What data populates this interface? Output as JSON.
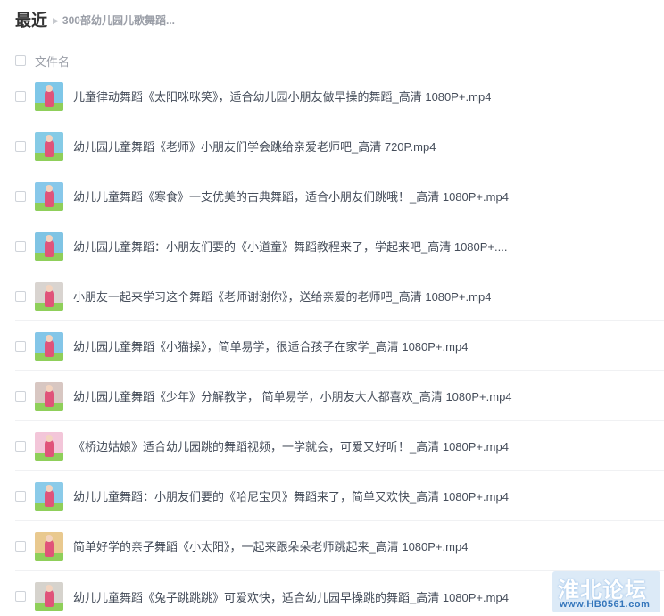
{
  "breadcrumb": {
    "root": "最近",
    "folder": "300部幼儿园儿歌舞蹈..."
  },
  "list_header": {
    "column_label": "文件名"
  },
  "files": [
    {
      "name": "儿童律动舞蹈《太阳咪咪笑》，适合幼儿园小朋友做早操的舞蹈_高清 1080P+.mp4",
      "thumb_color": "#7fc7e8"
    },
    {
      "name": "幼儿园儿童舞蹈《老师》小朋友们学会跳给亲爱老师吧_高清 720P.mp4",
      "thumb_color": "#86cbe6"
    },
    {
      "name": "幼儿儿童舞蹈《寒食》一支优美的古典舞蹈，适合小朋友们跳哦！_高清 1080P+.mp4",
      "thumb_color": "#88c8ea"
    },
    {
      "name": "幼儿园儿童舞蹈：小朋友们要的《小道童》舞蹈教程来了，学起来吧_高清 1080P+....",
      "thumb_color": "#80c4e4"
    },
    {
      "name": "小朋友一起来学习这个舞蹈《老师谢谢你》，送给亲爱的老师吧_高清 1080P+.mp4",
      "thumb_color": "#d9d4d0"
    },
    {
      "name": "幼儿园儿童舞蹈《小猫操》，简单易学，很适合孩子在家学_高清 1080P+.mp4",
      "thumb_color": "#84c6e8"
    },
    {
      "name": "幼儿园儿童舞蹈《少年》分解教学， 简单易学，小朋友大人都喜欢_高清 1080P+.mp4",
      "thumb_color": "#d8c7c2"
    },
    {
      "name": "《桥边姑娘》适合幼儿园跳的舞蹈视频，一学就会，可爱又好听！_高清 1080P+.mp4",
      "thumb_color": "#f3c6d9"
    },
    {
      "name": "幼儿儿童舞蹈：小朋友们要的《哈尼宝贝》舞蹈来了，简单又欢快_高清 1080P+.mp4",
      "thumb_color": "#8bcbe9"
    },
    {
      "name": "简单好学的亲子舞蹈《小太阳》，一起来跟朵朵老师跳起来_高清 1080P+.mp4",
      "thumb_color": "#e9c98f"
    },
    {
      "name": "幼儿儿童舞蹈《兔子跳跳跳》可爱欢快，适合幼儿园早操跳的舞蹈_高清 1080P+.mp4",
      "thumb_color": "#d6d3cd"
    }
  ],
  "watermark": {
    "title": "淮北论坛",
    "subtitle": "www.HB0561.com"
  }
}
